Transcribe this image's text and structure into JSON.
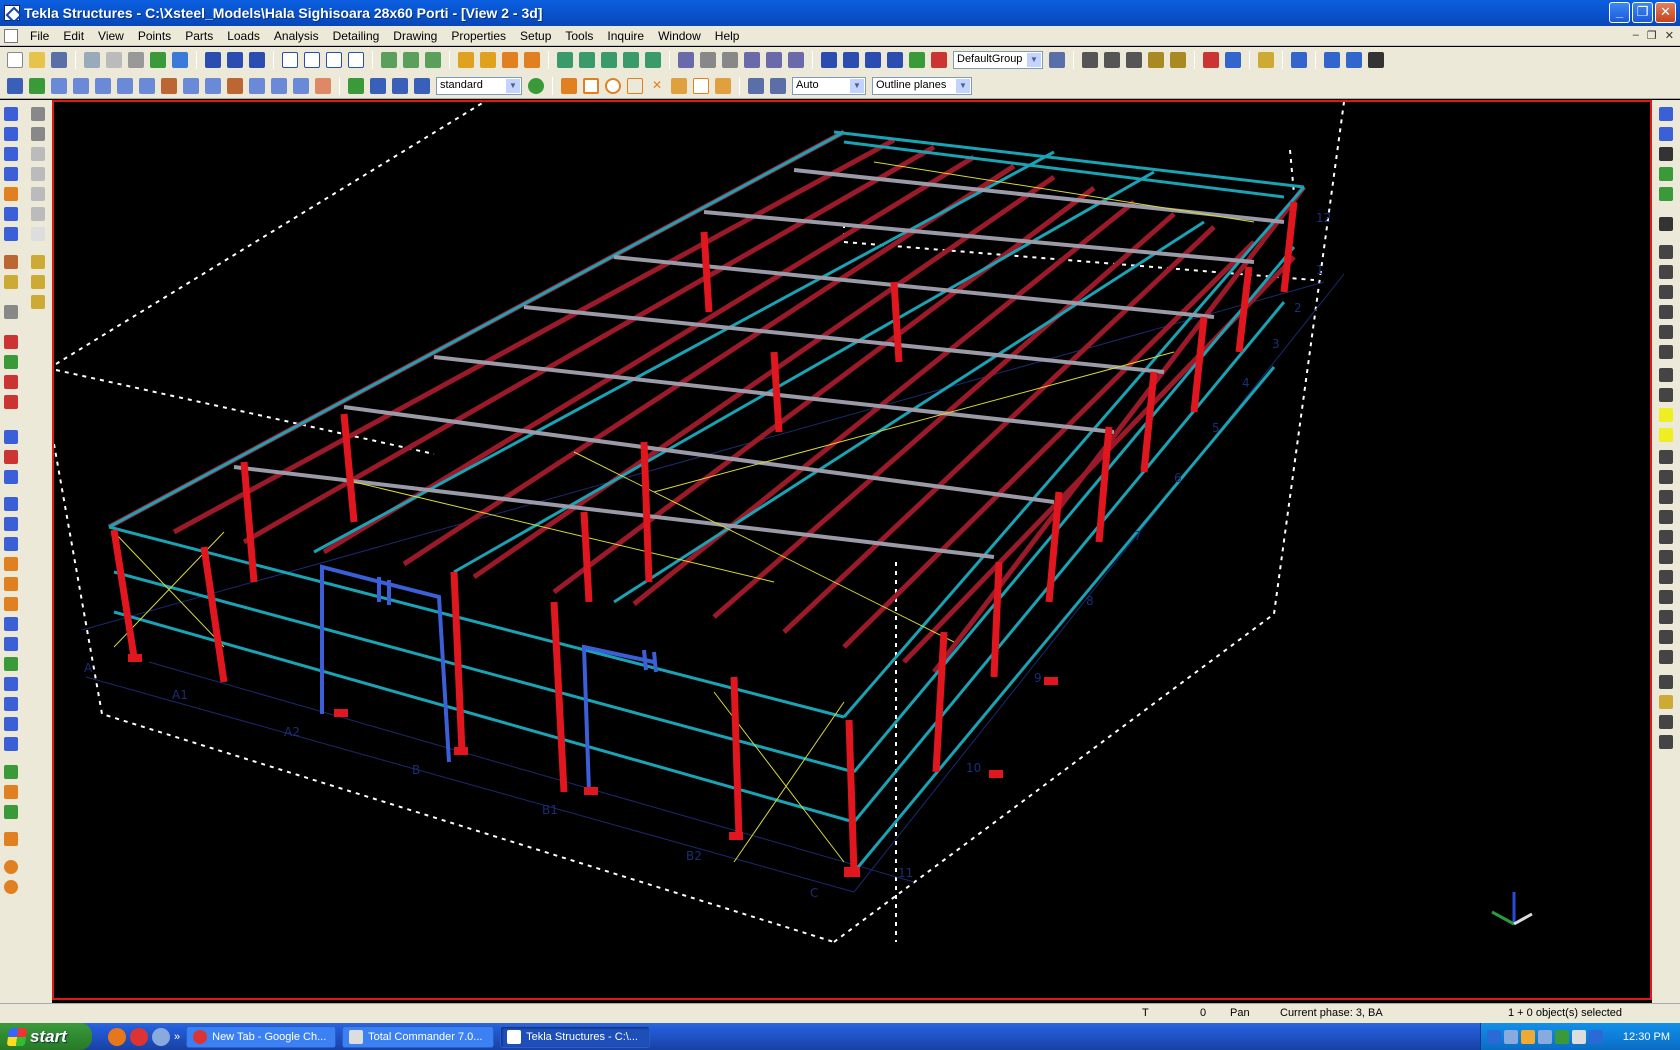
{
  "window": {
    "title": "Tekla Structures - C:\\Xsteel_Models\\Hala Sighisoara 28x60 Porti - [View 2 - 3d]"
  },
  "menu": [
    "File",
    "Edit",
    "View",
    "Points",
    "Parts",
    "Loads",
    "Analysis",
    "Detailing",
    "Drawing",
    "Properties",
    "Setup",
    "Tools",
    "Inquire",
    "Window",
    "Help"
  ],
  "toolbar": {
    "group_select": "DefaultGroup",
    "filter_select": "standard",
    "snap_select": "Auto",
    "plane_select": "Outline planes"
  },
  "viewport": {
    "grid_labels": {
      "front_a": "A",
      "front_a1": "A1",
      "front_a2": "A2",
      "front_b": "B",
      "front_b1": "B1",
      "front_b2": "B2",
      "front_c": "C",
      "side_1": "1",
      "side_2": "2",
      "side_3": "3",
      "side_4": "4",
      "side_5": "5",
      "side_6": "6",
      "side_7": "7",
      "side_8": "8",
      "side_9": "9",
      "side_10": "10",
      "side_11": "11",
      "side_12": "12"
    }
  },
  "status": {
    "t": "T",
    "zero": "0",
    "mode": "Pan",
    "phase": "Current phase: 3, BA",
    "selection": "1 + 0 object(s) selected"
  },
  "taskbar": {
    "start": "start",
    "tasks": [
      "New Tab - Google Ch...",
      "Total Commander 7.0...",
      "Tekla Structures - C:\\..."
    ],
    "clock": "12:30 PM"
  },
  "colors": {
    "column": "#e0171e",
    "rafter": "#9b1a2a",
    "purlin": "#1aa3b4",
    "door": "#3a5fd6",
    "brace": "#d8d83a",
    "frame_gray": "#9a9aa8"
  }
}
